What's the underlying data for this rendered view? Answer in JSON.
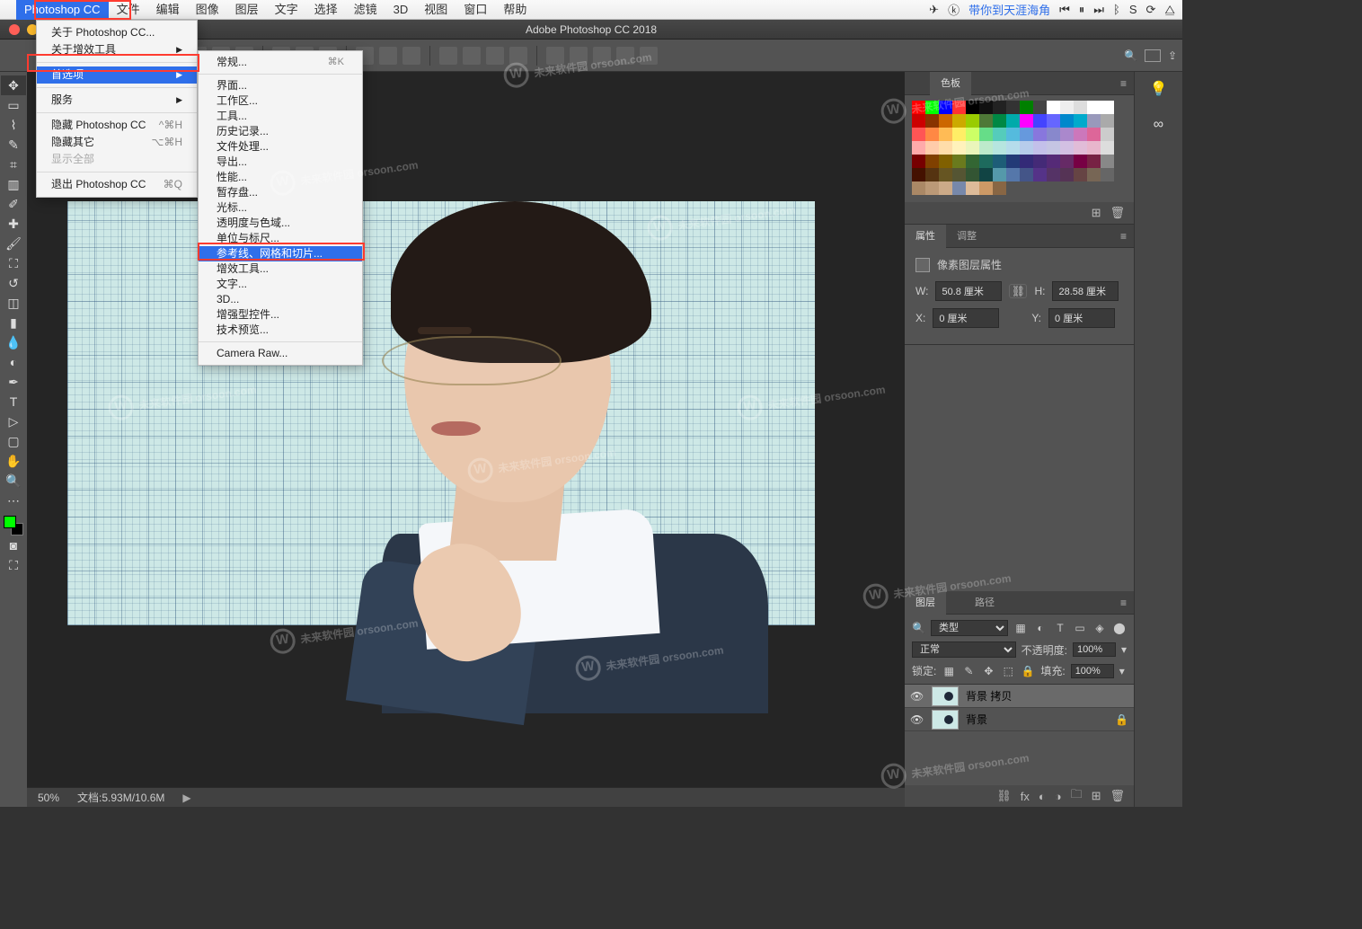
{
  "menubar": {
    "app": "Photoshop CC",
    "items": [
      "文件",
      "编辑",
      "图像",
      "图层",
      "文字",
      "选择",
      "滤镜",
      "3D",
      "视图",
      "窗口",
      "帮助"
    ],
    "song": "带你到天涯海角"
  },
  "window": {
    "title": "Adobe Photoshop CC 2018"
  },
  "dropdown1": {
    "about": "关于 Photoshop CC...",
    "plugins": "关于增效工具",
    "prefs": "首选项",
    "services": "服务",
    "hideps": "隐藏 Photoshop CC",
    "hideps_sc": "^⌘H",
    "hideothers": "隐藏其它",
    "hideothers_sc": "⌥⌘H",
    "showall": "显示全部",
    "quit": "退出 Photoshop CC",
    "quit_sc": "⌘Q"
  },
  "dropdown2": {
    "general": "常规...",
    "general_sc": "⌘K",
    "interface": "界面...",
    "workspace": "工作区...",
    "tools": "工具...",
    "history": "历史记录...",
    "filehandling": "文件处理...",
    "export": "导出...",
    "performance": "性能...",
    "scratch": "暂存盘...",
    "cursors": "光标...",
    "transparency": "透明度与色域...",
    "units": "单位与标尺...",
    "guides": "参考线、网格和切片...",
    "pluginstools": "增效工具...",
    "type": "文字...",
    "threeD": "3D...",
    "enhanced": "增强型控件...",
    "techpreview": "技术预览...",
    "cameraraw": "Camera Raw..."
  },
  "panels": {
    "swatches_tab": "色板",
    "props_tab": "属性",
    "adjust_tab": "调整",
    "props_title": "像素图层属性",
    "w_label": "W:",
    "w_val": "50.8 厘米",
    "h_label": "H:",
    "h_val": "28.58 厘米",
    "x_label": "X:",
    "x_val": "0 厘米",
    "y_label": "Y:",
    "y_val": "0 厘米",
    "layers_tab": "图层",
    "paths_tab": "路径",
    "kind": "类型",
    "blend": "正常",
    "opacity_label": "不透明度:",
    "opacity_val": "100%",
    "lock_label": "锁定:",
    "fill_label": "填充:",
    "fill_val": "100%",
    "layer1": "背景 拷贝",
    "layer2": "背景"
  },
  "status": {
    "zoom": "50%",
    "doc": "文档:5.93M/10.6M",
    "arrow": "▶"
  },
  "swatch_rows": [
    [
      "#ff0000",
      "#00ff00",
      "#0000ff",
      "#ff3333",
      "#000000",
      "#111111",
      "#222222",
      "#333333",
      "#008000",
      "#444444",
      "#ffffff",
      "#eeeeee",
      "#dddddd",
      "#ffffff",
      "#ffffff"
    ],
    [
      "#cc0000",
      "#883300",
      "#cc6600",
      "#ccaa00",
      "#99cc00",
      "#4e7837",
      "#008844",
      "#00aaaa",
      "#ff00ff",
      "#4444ff",
      "#6666ff",
      "#0088cc",
      "#00aacc",
      "#9999bb",
      "#aaaaaa"
    ],
    [
      "#ff5555",
      "#ff8844",
      "#ffbb55",
      "#ffee66",
      "#ccff66",
      "#66dd88",
      "#55ccbb",
      "#55bbdd",
      "#6699dd",
      "#8877dd",
      "#8888cc",
      "#aa88cc",
      "#cc77bb",
      "#dd6699",
      "#cccccc"
    ],
    [
      "#ffaaaa",
      "#ffccaa",
      "#ffddaa",
      "#fff2bb",
      "#eaf5bb",
      "#bdeacb",
      "#b6e5df",
      "#b5dceb",
      "#b7cceb",
      "#c3c0ea",
      "#c5c5e3",
      "#d3c0e3",
      "#e1bcd8",
      "#e8b6cc",
      "#dddddd"
    ],
    [
      "#770000",
      "#804000",
      "#806000",
      "#6a7a1d",
      "#336633",
      "#1d6a5d",
      "#1d5d77",
      "#223a77",
      "#332a77",
      "#442a77",
      "#552a77",
      "#662a66",
      "#770044",
      "#772244",
      "#888888"
    ],
    [
      "#441100",
      "#553311",
      "#665522",
      "#555533",
      "#335533",
      "#114444",
      "#5599aa",
      "#5577aa",
      "#445588",
      "#553388",
      "#553366",
      "#553355",
      "#664444",
      "#776655",
      "#666666"
    ],
    [
      "#aa8866",
      "#bb9977",
      "#ccaa88",
      "#7788aa",
      "#ddbb99",
      "#cc9966",
      "#886644",
      "",
      "",
      "",
      "",
      "",
      "",
      "",
      ""
    ]
  ],
  "watermark": "未来软件园 orsoon.com"
}
